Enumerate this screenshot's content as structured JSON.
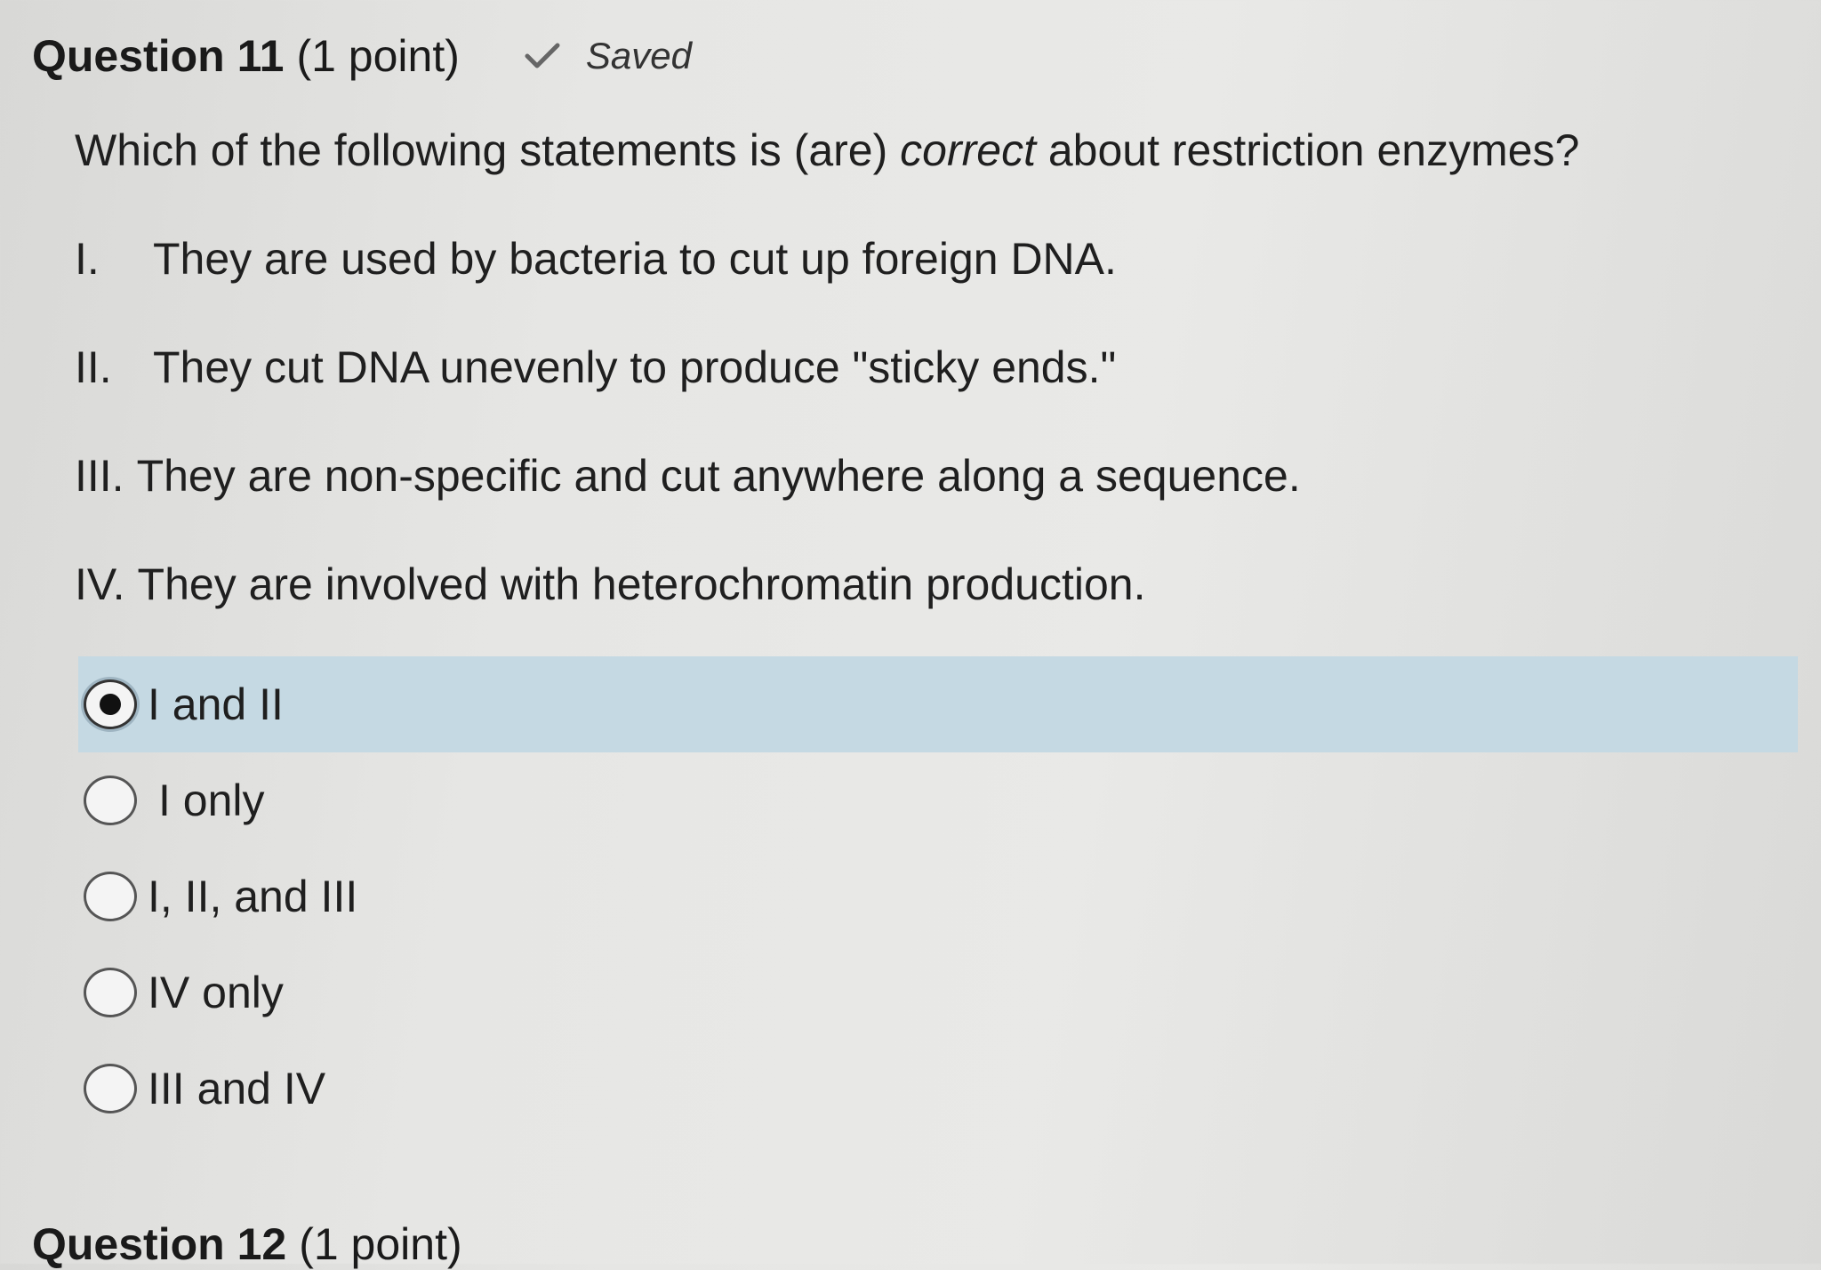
{
  "question": {
    "title": "Question 11",
    "points": "(1 point)",
    "status": "Saved",
    "status_icon": "check-icon",
    "prompt_before": "Which of the following statements is (are) ",
    "prompt_emphasis": "correct",
    "prompt_after": " about restriction enzymes?",
    "statements": [
      {
        "num": "I.",
        "text": "They are used by bacteria to cut up foreign DNA."
      },
      {
        "num": "II.",
        "text": "They cut DNA unevenly to produce \"sticky ends.\""
      },
      {
        "num": "III.",
        "text": "They are non-specific and cut anywhere along a sequence."
      },
      {
        "num": "IV.",
        "text": "They are involved with heterochromatin production."
      }
    ],
    "options": [
      {
        "label": "I and II",
        "selected": true
      },
      {
        "label": "I only",
        "selected": false
      },
      {
        "label": "I, II, and III",
        "selected": false
      },
      {
        "label": "IV only",
        "selected": false
      },
      {
        "label": "III and IV",
        "selected": false
      }
    ],
    "selected_color": "#c5d9e3"
  },
  "next_question": {
    "title": "Question 12",
    "points": "(1 point)"
  }
}
